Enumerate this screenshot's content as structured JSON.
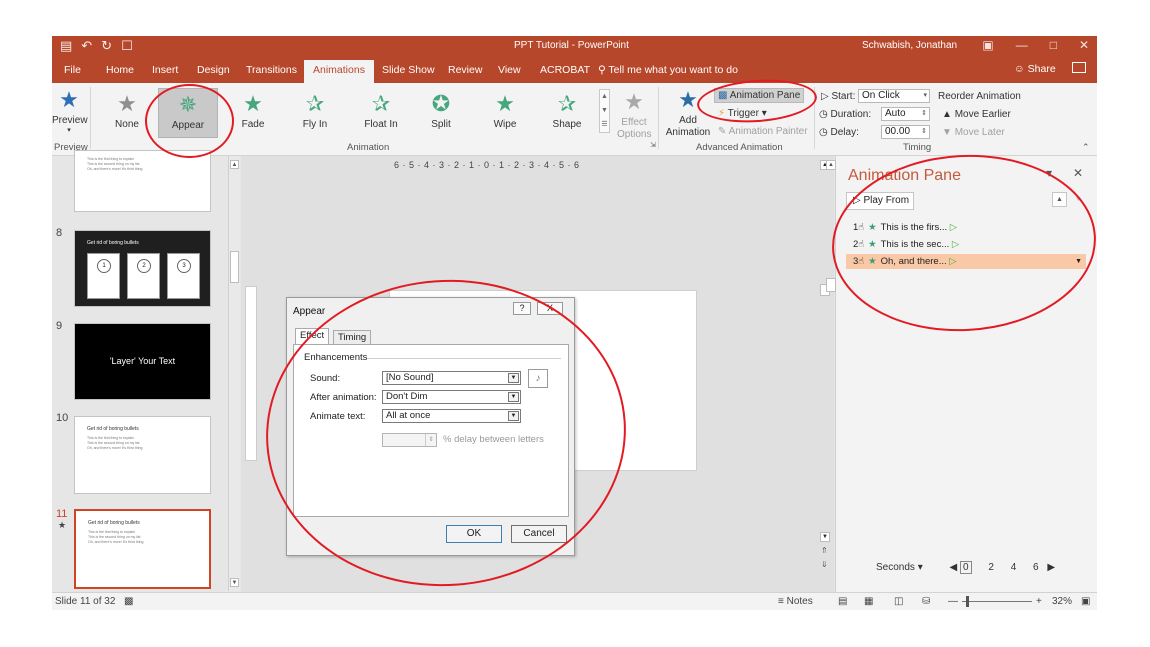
{
  "titlebar": {
    "doc_title": "PPT Tutorial  -  PowerPoint",
    "user": "Schwabish, Jonathan",
    "qat_icons": [
      "save-icon",
      "undo-icon",
      "redo-icon",
      "new-file-icon"
    ]
  },
  "tabs": [
    "File",
    "Home",
    "Insert",
    "Design",
    "Transitions",
    "Animations",
    "Slide Show",
    "Review",
    "View",
    "ACROBAT"
  ],
  "active_tab": "Animations",
  "tell_me": "Tell me what you want to do",
  "share": "Share",
  "ribbon": {
    "preview": {
      "label": "Preview",
      "group": "Preview"
    },
    "animations": [
      {
        "label": "None",
        "style": "grey"
      },
      {
        "label": "Appear",
        "style": "green",
        "selected": true
      },
      {
        "label": "Fade",
        "style": "green"
      },
      {
        "label": "Fly In",
        "style": "green-out"
      },
      {
        "label": "Float In",
        "style": "green-out"
      },
      {
        "label": "Split",
        "style": "green"
      },
      {
        "label": "Wipe",
        "style": "green"
      },
      {
        "label": "Shape",
        "style": "green-out"
      }
    ],
    "animation_group": "Animation",
    "effect_options": "Effect Options",
    "add_animation": "Add Animation",
    "animation_pane_btn": "Animation Pane",
    "trigger": "Trigger",
    "animation_painter": "Animation Painter",
    "advanced_group": "Advanced Animation",
    "start_label": "Start:",
    "start_value": "On Click",
    "duration_label": "Duration:",
    "duration_value": "Auto",
    "delay_label": "Delay:",
    "delay_value": "00.00",
    "reorder": "Reorder Animation",
    "move_earlier": "Move Earlier",
    "move_later": "Move Later",
    "timing_group": "Timing"
  },
  "slides": {
    "numbers": [
      "8",
      "9",
      "10",
      "11"
    ],
    "thumb_title_bullets": "Get rid of boring bullets",
    "thumb_title_layer": "'Layer' Your Text",
    "thumb_lines": [
      "This is the first thing to explain",
      "This is the second thing on my list",
      "Oh, and there's more! It's third thing"
    ],
    "box_nums": [
      "1",
      "2",
      "3"
    ]
  },
  "ruler_text": "6 · 5 · 4 · 3 · 2 · 1 · 0 · 1 · 2 · 3 · 4 · 5 · 6",
  "dialog": {
    "title": "Appear",
    "help": "?",
    "close": "X",
    "tab_effect": "Effect",
    "tab_timing": "Timing",
    "enhancements": "Enhancements",
    "sound_label": "Sound:",
    "sound_value": "[No Sound]",
    "after_label": "After animation:",
    "after_value": "Don't Dim",
    "animate_label": "Animate text:",
    "animate_value": "All at once",
    "delay_text": "% delay between letters",
    "ok": "OK",
    "cancel": "Cancel"
  },
  "anim_pane": {
    "title": "Animation Pane",
    "play_from": "Play From",
    "items": [
      {
        "num": "1",
        "text": "This is the firs..."
      },
      {
        "num": "2",
        "text": "This is the sec..."
      },
      {
        "num": "3",
        "text": "Oh, and there..."
      }
    ],
    "selected_index": 2,
    "seconds": "Seconds",
    "timeline": [
      "0",
      "2",
      "4",
      "6"
    ]
  },
  "statusbar": {
    "slide_info": "Slide 11 of 32",
    "notes": "Notes",
    "zoom": "32%"
  },
  "colors": {
    "brand": "#b7472a",
    "selected_item": "#f9c8a6",
    "annotation": "#e21b23",
    "star_green": "#46a67e"
  }
}
